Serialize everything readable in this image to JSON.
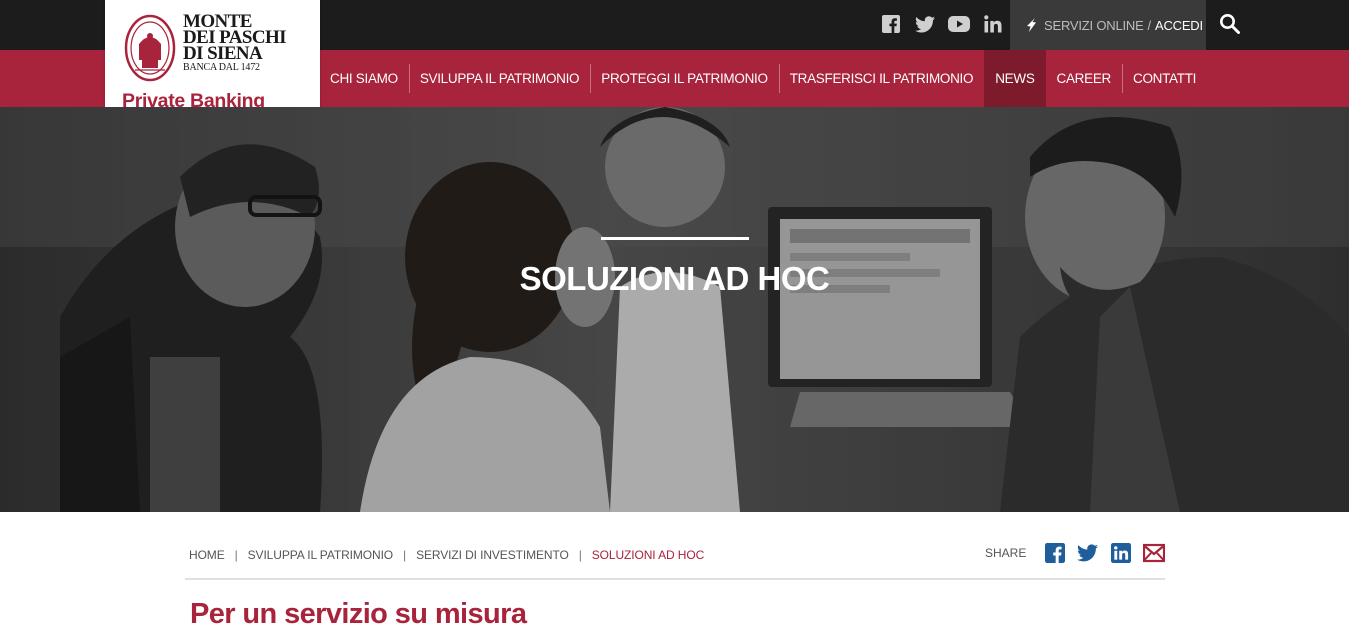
{
  "brand": {
    "bank_line1": "MONTE",
    "bank_line2": "DEI PASCHI",
    "bank_line3": "DI SIENA",
    "bank_since": "BANCA DAL 1472",
    "division": "Private Banking",
    "accent_color": "#a8233c"
  },
  "topbar": {
    "social": [
      "facebook-icon",
      "twitter-icon",
      "youtube-icon",
      "linkedin-icon"
    ],
    "servizi_label": "SERVIZI ONLINE",
    "separator": "/",
    "accedi_label": "ACCEDI",
    "search_icon": "search-icon"
  },
  "nav": {
    "items": [
      {
        "label": "CHI SIAMO",
        "active": false
      },
      {
        "label": "SVILUPPA IL PATRIMONIO",
        "active": false
      },
      {
        "label": "PROTEGGI IL PATRIMONIO",
        "active": false
      },
      {
        "label": "TRASFERISCI IL PATRIMONIO",
        "active": false
      },
      {
        "label": "NEWS",
        "active": true
      },
      {
        "label": "CAREER",
        "active": false
      },
      {
        "label": "CONTATTI",
        "active": false
      }
    ]
  },
  "hero": {
    "title": "SOLUZIONI AD HOC"
  },
  "breadcrumb": {
    "items": [
      "HOME",
      "SVILUPPA IL PATRIMONIO",
      "SERVIZI DI INVESTIMENTO",
      "SOLUZIONI AD HOC"
    ],
    "separator": "|"
  },
  "share": {
    "label": "SHARE",
    "icons": [
      "facebook-icon",
      "twitter-icon",
      "linkedin-icon",
      "email-icon"
    ],
    "icon_color": "#1f5e9a",
    "email_color": "#a8233c"
  },
  "content": {
    "heading": "Per un servizio su misura"
  }
}
